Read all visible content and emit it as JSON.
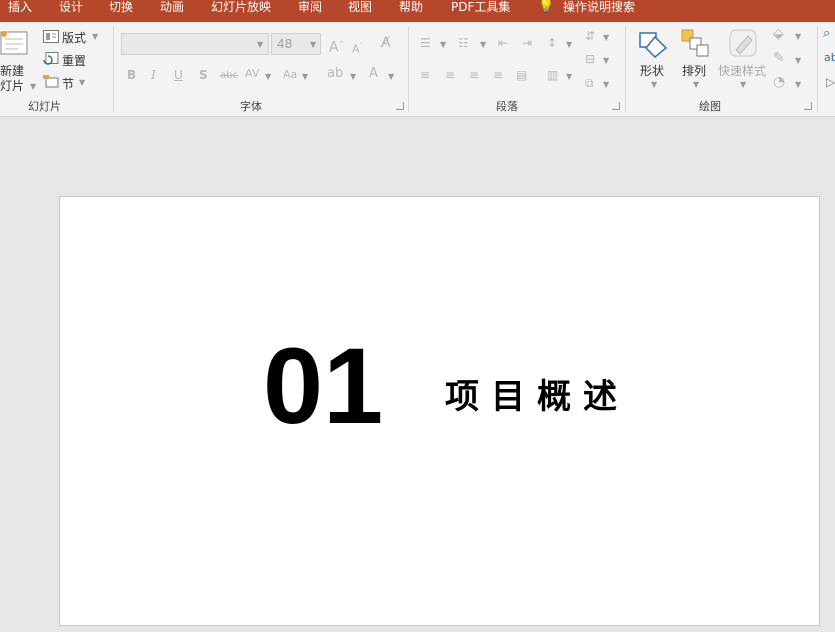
{
  "menu": {
    "items": [
      "插入",
      "设计",
      "切换",
      "动画",
      "幻灯片放映",
      "审阅",
      "视图",
      "帮助",
      "PDF工具集"
    ],
    "search": "操作说明搜索"
  },
  "ribbon": {
    "slides": {
      "new_slide": [
        "新建",
        "灯片"
      ],
      "layout": "版式",
      "reset": "重置",
      "section": "节",
      "group_label": "幻灯片"
    },
    "font": {
      "font_name": "",
      "font_size": "48",
      "group_label": "字体"
    },
    "paragraph": {
      "group_label": "段落"
    },
    "drawing": {
      "shape": "形状",
      "arrange": "排列",
      "quick_styles": "快速样式",
      "group_label": "绘图"
    }
  },
  "slide": {
    "number": "01",
    "title": "项目概述"
  },
  "colors": {
    "accent": "#b7472a",
    "ribbon": "#f3f3f3",
    "workspace": "#e6e6e6"
  }
}
